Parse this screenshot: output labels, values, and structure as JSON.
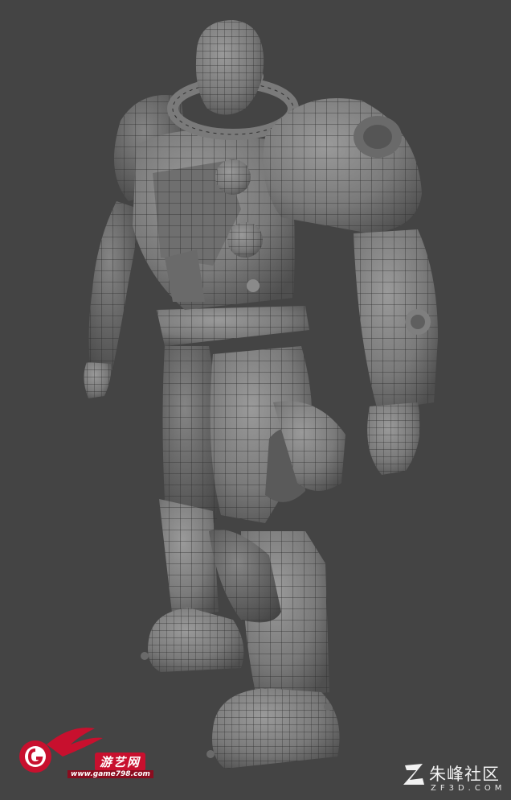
{
  "scene": {
    "description_icon": "armored-character-wireframe-render",
    "background_color": "#444444",
    "model_color": "#7d7d7d",
    "wire_color": "#2e2e2e"
  },
  "watermark_left": {
    "cn_text": "游艺网",
    "url_text": "www.game798.com",
    "accent_color": "#c8102e"
  },
  "watermark_right": {
    "cn_text": "朱峰社区",
    "en_text": "ZF3D.COM"
  }
}
